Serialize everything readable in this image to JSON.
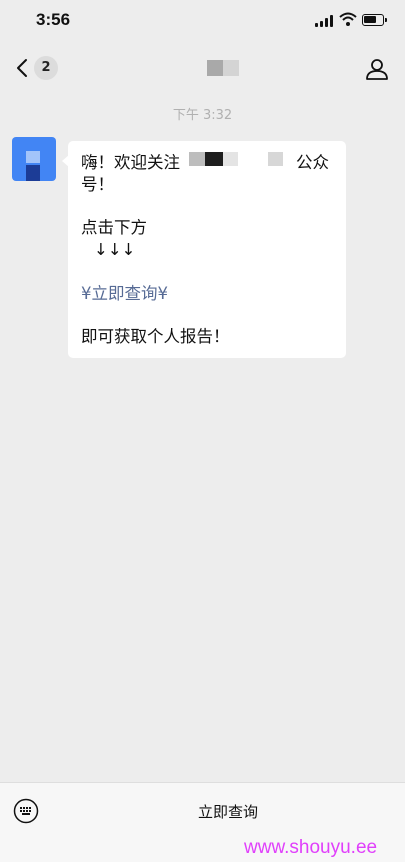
{
  "status": {
    "time": "3:56"
  },
  "nav": {
    "unread_count": "2"
  },
  "chat": {
    "timestamp": "下午 3:32",
    "message": {
      "line1_start": "嗨！欢迎关注",
      "line1_end": "公众",
      "line2": "号！",
      "line3": "点击下方",
      "line4": "↓↓↓",
      "link": "¥立即查询¥",
      "line6": "即可获取个人报告！"
    }
  },
  "bottom": {
    "keyboard_icon": "keyboard-icon",
    "menu_label": "立即查询"
  },
  "watermark": "www.shouyu.ee",
  "colors": {
    "link": "#576b95",
    "avatar": "#4285f4",
    "watermark": "#e040fb"
  }
}
